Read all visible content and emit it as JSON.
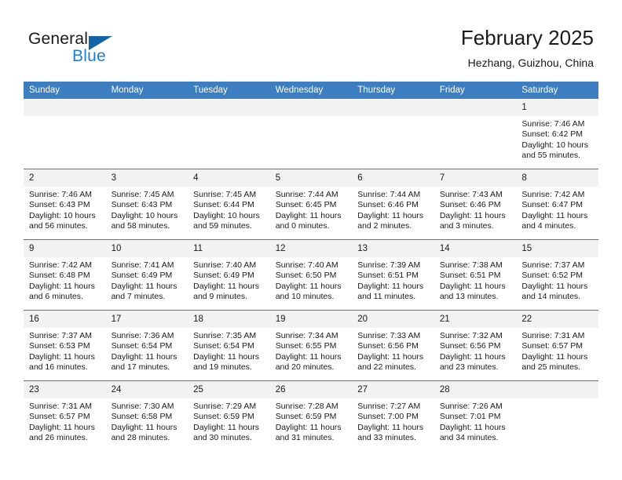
{
  "brand": {
    "name_part1": "General",
    "name_part2": "Blue",
    "logo_icon": "blue-triangle-icon",
    "accent_color": "#1464aa",
    "blue_text_color": "#1a7fd4"
  },
  "header": {
    "title": "February 2025",
    "location": "Hezhang, Guizhou, China"
  },
  "calendar": {
    "header_bg": "#3c7ebf",
    "daynum_bg": "#f2f2f2",
    "weekday_labels": [
      "Sunday",
      "Monday",
      "Tuesday",
      "Wednesday",
      "Thursday",
      "Friday",
      "Saturday"
    ],
    "weeks": [
      [
        {
          "day": "",
          "sunrise": "",
          "sunset": "",
          "daylight": ""
        },
        {
          "day": "",
          "sunrise": "",
          "sunset": "",
          "daylight": ""
        },
        {
          "day": "",
          "sunrise": "",
          "sunset": "",
          "daylight": ""
        },
        {
          "day": "",
          "sunrise": "",
          "sunset": "",
          "daylight": ""
        },
        {
          "day": "",
          "sunrise": "",
          "sunset": "",
          "daylight": ""
        },
        {
          "day": "",
          "sunrise": "",
          "sunset": "",
          "daylight": ""
        },
        {
          "day": "1",
          "sunrise": "Sunrise: 7:46 AM",
          "sunset": "Sunset: 6:42 PM",
          "daylight": "Daylight: 10 hours and 55 minutes."
        }
      ],
      [
        {
          "day": "2",
          "sunrise": "Sunrise: 7:46 AM",
          "sunset": "Sunset: 6:43 PM",
          "daylight": "Daylight: 10 hours and 56 minutes."
        },
        {
          "day": "3",
          "sunrise": "Sunrise: 7:45 AM",
          "sunset": "Sunset: 6:43 PM",
          "daylight": "Daylight: 10 hours and 58 minutes."
        },
        {
          "day": "4",
          "sunrise": "Sunrise: 7:45 AM",
          "sunset": "Sunset: 6:44 PM",
          "daylight": "Daylight: 10 hours and 59 minutes."
        },
        {
          "day": "5",
          "sunrise": "Sunrise: 7:44 AM",
          "sunset": "Sunset: 6:45 PM",
          "daylight": "Daylight: 11 hours and 0 minutes."
        },
        {
          "day": "6",
          "sunrise": "Sunrise: 7:44 AM",
          "sunset": "Sunset: 6:46 PM",
          "daylight": "Daylight: 11 hours and 2 minutes."
        },
        {
          "day": "7",
          "sunrise": "Sunrise: 7:43 AM",
          "sunset": "Sunset: 6:46 PM",
          "daylight": "Daylight: 11 hours and 3 minutes."
        },
        {
          "day": "8",
          "sunrise": "Sunrise: 7:42 AM",
          "sunset": "Sunset: 6:47 PM",
          "daylight": "Daylight: 11 hours and 4 minutes."
        }
      ],
      [
        {
          "day": "9",
          "sunrise": "Sunrise: 7:42 AM",
          "sunset": "Sunset: 6:48 PM",
          "daylight": "Daylight: 11 hours and 6 minutes."
        },
        {
          "day": "10",
          "sunrise": "Sunrise: 7:41 AM",
          "sunset": "Sunset: 6:49 PM",
          "daylight": "Daylight: 11 hours and 7 minutes."
        },
        {
          "day": "11",
          "sunrise": "Sunrise: 7:40 AM",
          "sunset": "Sunset: 6:49 PM",
          "daylight": "Daylight: 11 hours and 9 minutes."
        },
        {
          "day": "12",
          "sunrise": "Sunrise: 7:40 AM",
          "sunset": "Sunset: 6:50 PM",
          "daylight": "Daylight: 11 hours and 10 minutes."
        },
        {
          "day": "13",
          "sunrise": "Sunrise: 7:39 AM",
          "sunset": "Sunset: 6:51 PM",
          "daylight": "Daylight: 11 hours and 11 minutes."
        },
        {
          "day": "14",
          "sunrise": "Sunrise: 7:38 AM",
          "sunset": "Sunset: 6:51 PM",
          "daylight": "Daylight: 11 hours and 13 minutes."
        },
        {
          "day": "15",
          "sunrise": "Sunrise: 7:37 AM",
          "sunset": "Sunset: 6:52 PM",
          "daylight": "Daylight: 11 hours and 14 minutes."
        }
      ],
      [
        {
          "day": "16",
          "sunrise": "Sunrise: 7:37 AM",
          "sunset": "Sunset: 6:53 PM",
          "daylight": "Daylight: 11 hours and 16 minutes."
        },
        {
          "day": "17",
          "sunrise": "Sunrise: 7:36 AM",
          "sunset": "Sunset: 6:54 PM",
          "daylight": "Daylight: 11 hours and 17 minutes."
        },
        {
          "day": "18",
          "sunrise": "Sunrise: 7:35 AM",
          "sunset": "Sunset: 6:54 PM",
          "daylight": "Daylight: 11 hours and 19 minutes."
        },
        {
          "day": "19",
          "sunrise": "Sunrise: 7:34 AM",
          "sunset": "Sunset: 6:55 PM",
          "daylight": "Daylight: 11 hours and 20 minutes."
        },
        {
          "day": "20",
          "sunrise": "Sunrise: 7:33 AM",
          "sunset": "Sunset: 6:56 PM",
          "daylight": "Daylight: 11 hours and 22 minutes."
        },
        {
          "day": "21",
          "sunrise": "Sunrise: 7:32 AM",
          "sunset": "Sunset: 6:56 PM",
          "daylight": "Daylight: 11 hours and 23 minutes."
        },
        {
          "day": "22",
          "sunrise": "Sunrise: 7:31 AM",
          "sunset": "Sunset: 6:57 PM",
          "daylight": "Daylight: 11 hours and 25 minutes."
        }
      ],
      [
        {
          "day": "23",
          "sunrise": "Sunrise: 7:31 AM",
          "sunset": "Sunset: 6:57 PM",
          "daylight": "Daylight: 11 hours and 26 minutes."
        },
        {
          "day": "24",
          "sunrise": "Sunrise: 7:30 AM",
          "sunset": "Sunset: 6:58 PM",
          "daylight": "Daylight: 11 hours and 28 minutes."
        },
        {
          "day": "25",
          "sunrise": "Sunrise: 7:29 AM",
          "sunset": "Sunset: 6:59 PM",
          "daylight": "Daylight: 11 hours and 30 minutes."
        },
        {
          "day": "26",
          "sunrise": "Sunrise: 7:28 AM",
          "sunset": "Sunset: 6:59 PM",
          "daylight": "Daylight: 11 hours and 31 minutes."
        },
        {
          "day": "27",
          "sunrise": "Sunrise: 7:27 AM",
          "sunset": "Sunset: 7:00 PM",
          "daylight": "Daylight: 11 hours and 33 minutes."
        },
        {
          "day": "28",
          "sunrise": "Sunrise: 7:26 AM",
          "sunset": "Sunset: 7:01 PM",
          "daylight": "Daylight: 11 hours and 34 minutes."
        },
        {
          "day": "",
          "sunrise": "",
          "sunset": "",
          "daylight": ""
        }
      ]
    ]
  }
}
